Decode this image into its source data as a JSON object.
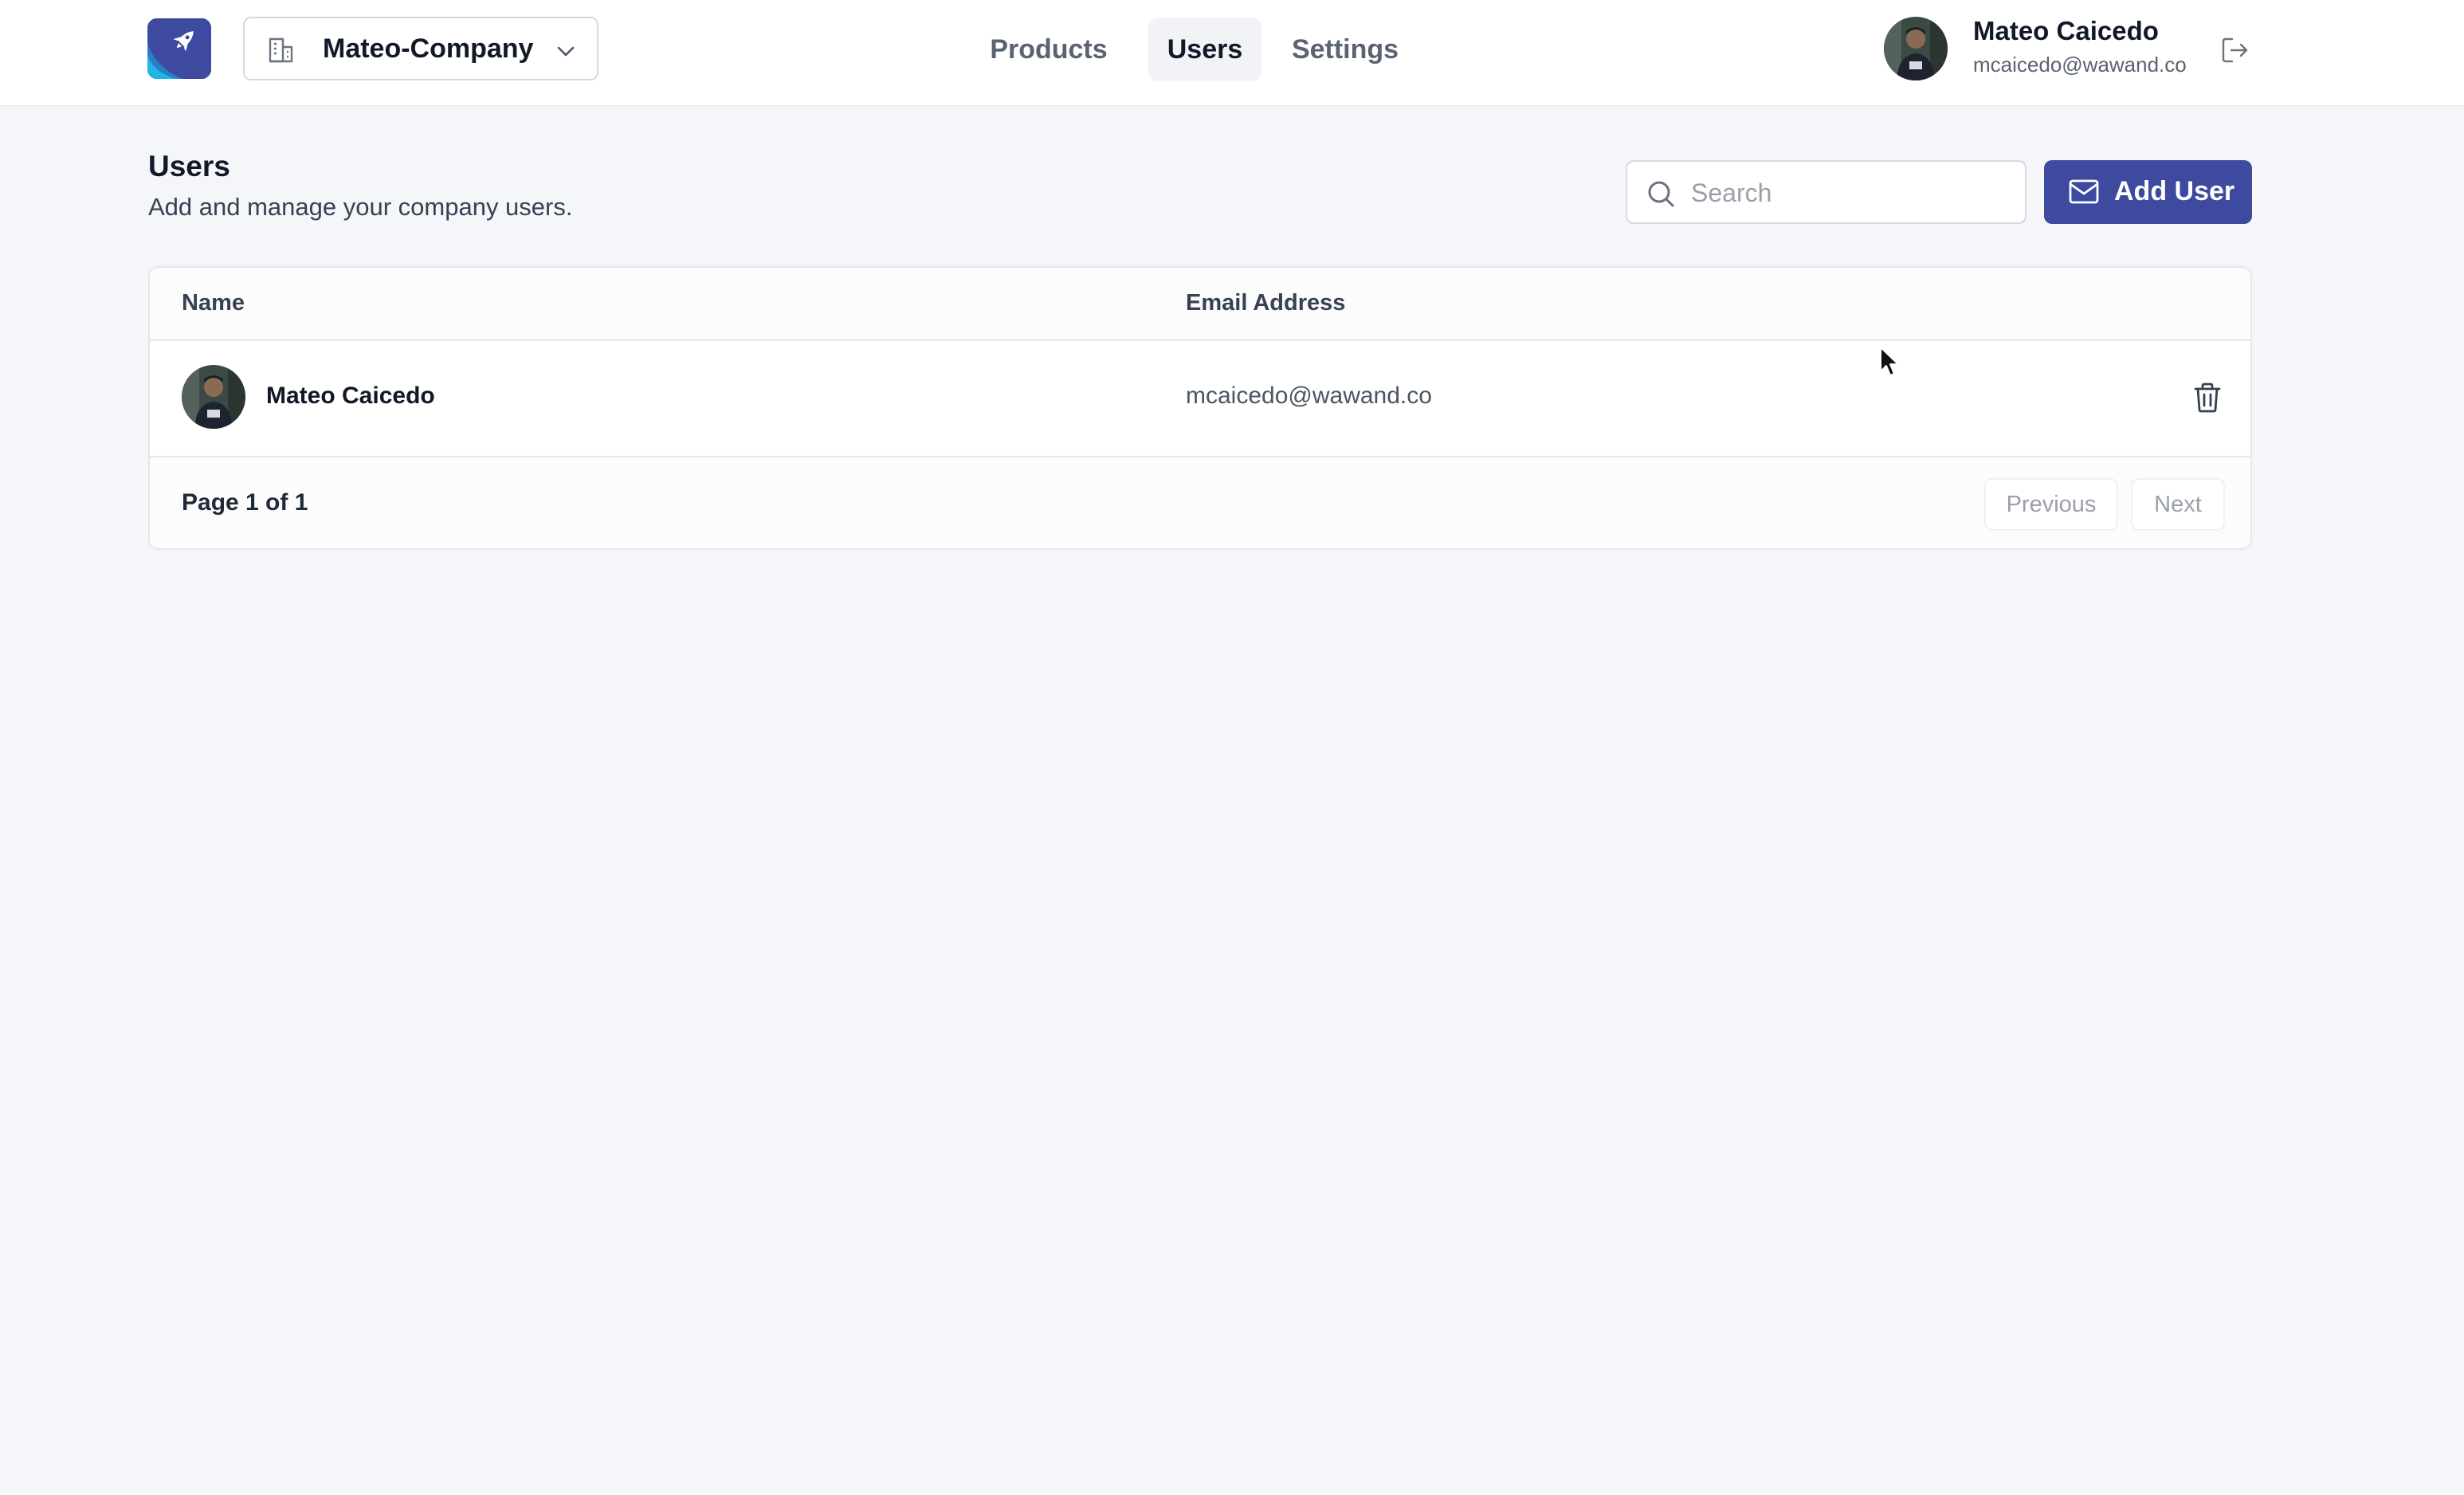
{
  "header": {
    "company": "Mateo-Company",
    "nav": [
      {
        "label": "Products",
        "active": false
      },
      {
        "label": "Users",
        "active": true
      },
      {
        "label": "Settings",
        "active": false
      }
    ],
    "user": {
      "name": "Mateo Caicedo",
      "email": "mcaicedo@wawand.co"
    }
  },
  "page": {
    "title": "Users",
    "subtitle": "Add and manage your company users.",
    "search_placeholder": "Search",
    "add_button": "Add User"
  },
  "table": {
    "columns": [
      "Name",
      "Email Address"
    ],
    "rows": [
      {
        "name": "Mateo Caicedo",
        "email": "mcaicedo@wawand.co"
      }
    ],
    "page_info": "Page 1 of 1",
    "previous": "Previous",
    "next": "Next"
  },
  "colors": {
    "accent": "#3e4aa0",
    "background": "#f4f6fa",
    "logo_cyan": "#1fb6e8"
  },
  "icons": [
    "rocket-logo-icon",
    "building-icon",
    "chevron-down-icon",
    "logout-icon",
    "search-icon",
    "mail-icon",
    "trash-icon",
    "cursor-icon"
  ]
}
